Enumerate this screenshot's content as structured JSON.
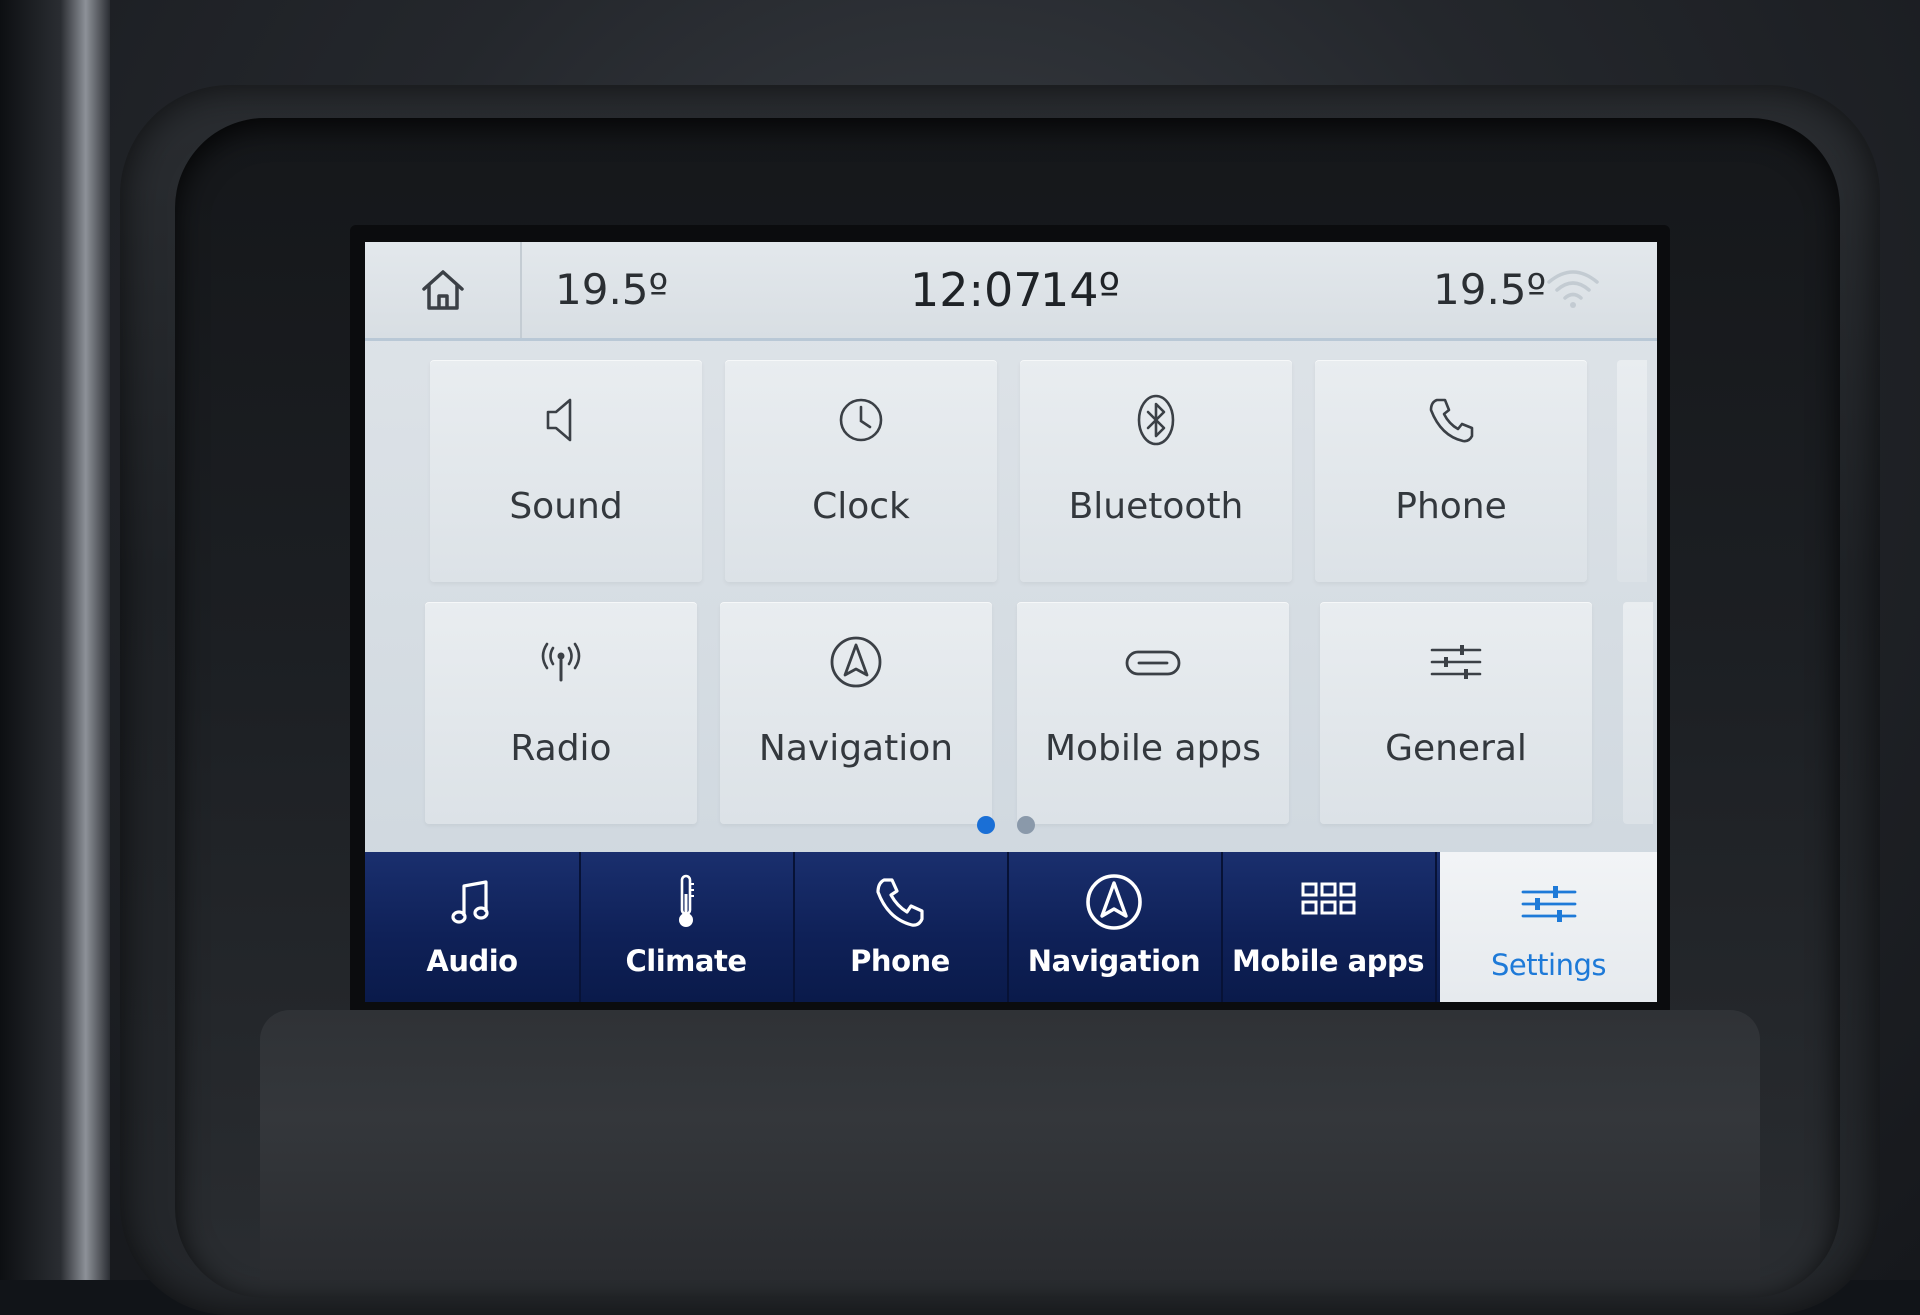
{
  "status_bar": {
    "left_temp": "19.5º",
    "time": "12:07",
    "outside_temp": "14º",
    "right_temp": "19.5º"
  },
  "settings_grid": {
    "tiles": [
      {
        "label": "Sound",
        "icon": "speaker-icon"
      },
      {
        "label": "Clock",
        "icon": "clock-icon"
      },
      {
        "label": "Bluetooth",
        "icon": "bluetooth-icon"
      },
      {
        "label": "Phone",
        "icon": "phone-icon"
      },
      {
        "label": "Radio",
        "icon": "antenna-icon"
      },
      {
        "label": "Navigation",
        "icon": "navigation-arrow-icon"
      },
      {
        "label": "Mobile apps",
        "icon": "link-icon"
      },
      {
        "label": "General",
        "icon": "sliders-icon"
      }
    ],
    "pages": {
      "current": 1,
      "total": 2
    }
  },
  "bottom_nav": {
    "items": [
      {
        "label": "Audio",
        "icon": "music-note-icon"
      },
      {
        "label": "Climate",
        "icon": "thermometer-icon"
      },
      {
        "label": "Phone",
        "icon": "phone-icon"
      },
      {
        "label": "Navigation",
        "icon": "navigation-arrow-icon"
      },
      {
        "label": "Mobile apps",
        "icon": "apps-grid-icon"
      },
      {
        "label": "Settings",
        "icon": "sliders-icon"
      }
    ],
    "active": "Settings"
  },
  "colors": {
    "nav_background": "#0f2158",
    "active_accent": "#1e7ad8",
    "page_dot_active": "#1a6fd6",
    "page_dot_inactive": "#8a99aa"
  }
}
